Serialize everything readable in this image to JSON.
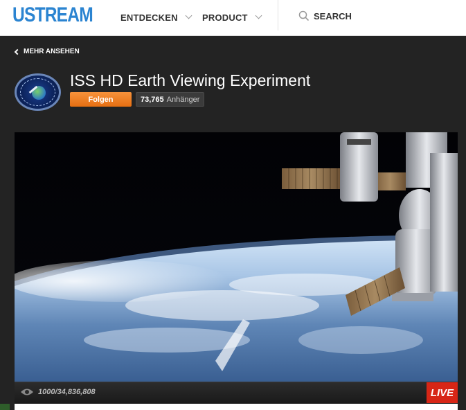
{
  "header": {
    "logo": "USTREAM",
    "nav": [
      {
        "label": "ENTDECKEN"
      },
      {
        "label": "PRODUCT"
      }
    ],
    "search_label": "SEARCH"
  },
  "back_link": "MEHR ANSEHEN",
  "channel": {
    "title": "ISS HD Earth Viewing Experiment",
    "follow_label": "Folgen",
    "followers_count": "73,765",
    "followers_label": "Anhänger"
  },
  "player": {
    "views": "1000/34,836,808",
    "live_label": "LIVE"
  },
  "colors": {
    "brand": "#2b84d1",
    "follow": "#f28325",
    "live": "#d72616",
    "background": "#232323"
  },
  "icons": [
    "chevron-down-icon",
    "search-icon",
    "chevron-left-icon",
    "eye-icon"
  ]
}
